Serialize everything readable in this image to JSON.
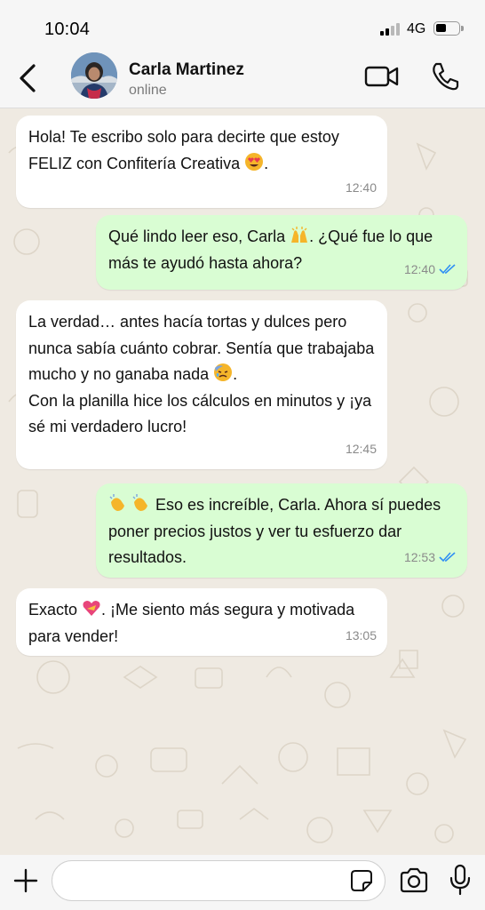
{
  "status_bar": {
    "time": "10:04",
    "network": "4G"
  },
  "header": {
    "contact_name": "Carla Martinez",
    "contact_status": "online"
  },
  "icons": {
    "back": "chevron-left-icon",
    "video": "video-camera-icon",
    "call": "phone-icon",
    "attach": "plus-icon",
    "sticker": "sticker-icon",
    "camera": "camera-icon",
    "mic": "microphone-icon",
    "read": "double-check-icon"
  },
  "colors": {
    "incoming_bubble": "#ffffff",
    "outgoing_bubble": "#d9fdd3",
    "chat_background": "#efeae2",
    "read_ticks": "#2e8ef5"
  },
  "messages": [
    {
      "direction": "incoming",
      "text_before": "Hola! Te escribo solo para decirte que estoy FELIZ con Confitería Creativa ",
      "emoji": "smiling-face-with-heart-eyes",
      "text_after": ".",
      "time": "12:40"
    },
    {
      "direction": "outgoing",
      "text_before": "Qué lindo leer eso, Carla ",
      "emoji": "raising-hands",
      "text_after": ". ¿Qué fue lo que más te ayudó hasta ahora?",
      "time": "12:40",
      "read": true
    },
    {
      "direction": "incoming",
      "text_before": "La verdad… antes hacía tortas y dulces pero nunca sabía cuánto cobrar. Sentía que trabajaba mucho y no ganaba nada ",
      "emoji": "downcast-face-with-sweat",
      "text_after": ".\nCon la planilla hice los cálculos en minutos y ¡ya sé mi verdadero lucro!",
      "time": "12:45"
    },
    {
      "direction": "outgoing",
      "text_before": "",
      "emoji": "clapping-hands",
      "text_after": " Eso es increíble, Carla. Ahora sí puedes poner precios justos y ver tu esfuerzo dar resultados.",
      "time": "12:53",
      "read": true
    },
    {
      "direction": "incoming",
      "text_before": "Exacto ",
      "emoji": "heart-with-ribbon",
      "text_after": ". ¡Me siento más segura y motivada para vender!",
      "time": "13:05"
    }
  ],
  "composer": {
    "value": ""
  }
}
